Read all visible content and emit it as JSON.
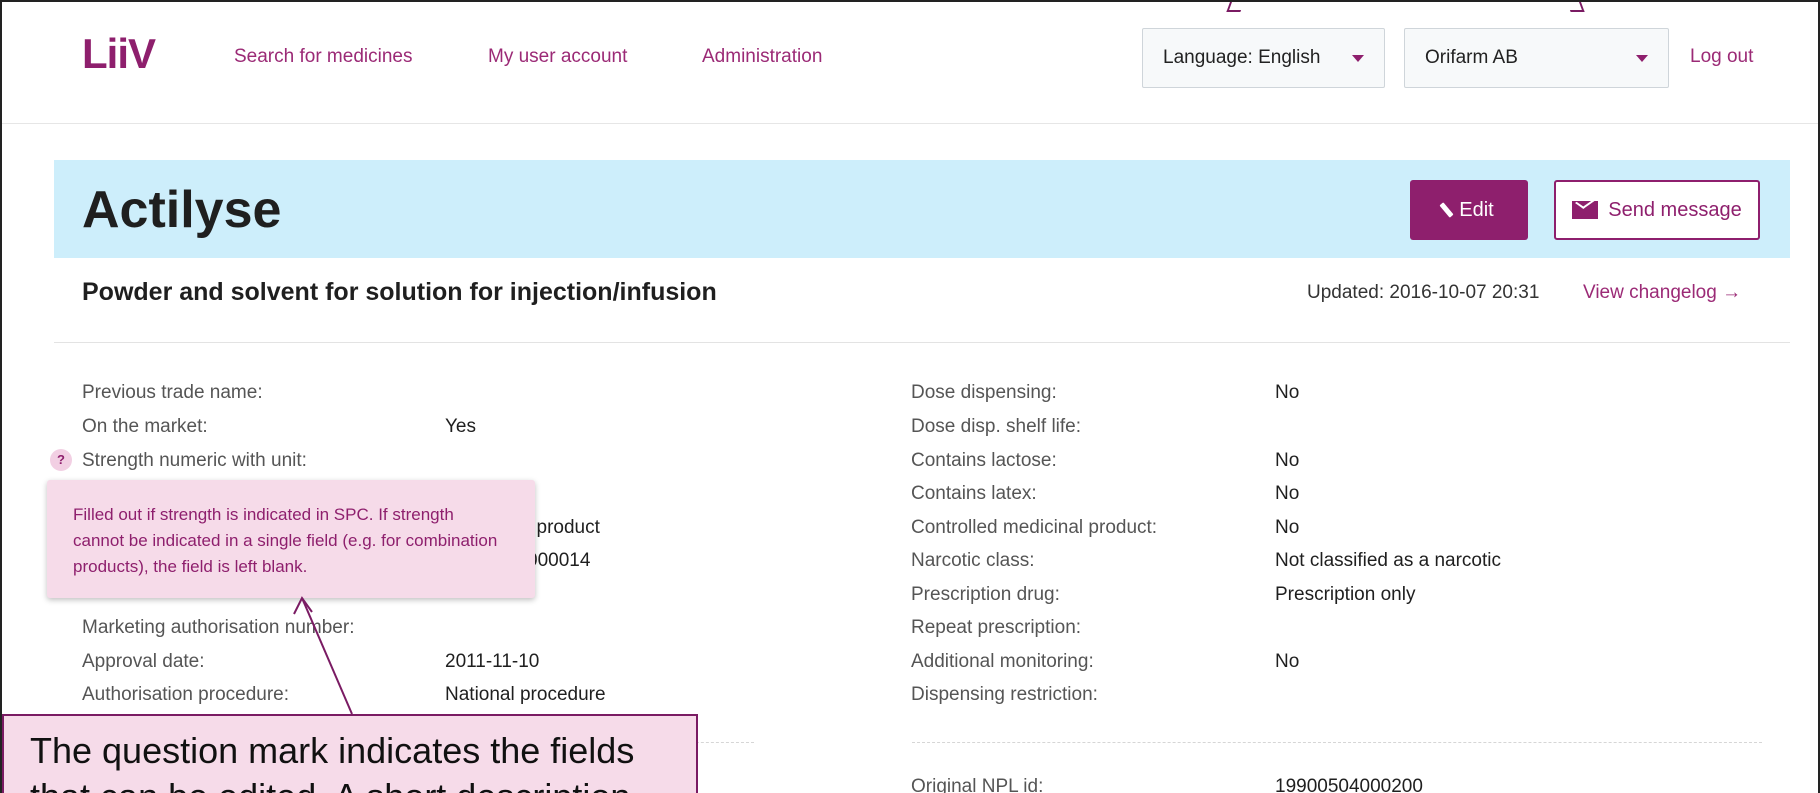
{
  "header": {
    "logo": "LiiV",
    "nav": [
      "Search for medicines",
      "My user account",
      "Administration"
    ],
    "language_select": "Language: English",
    "company_select": "Orifarm AB",
    "logout": "Log out"
  },
  "product": {
    "name": "Actilyse",
    "edit_label": "Edit",
    "message_label": "Send message",
    "form": "Powder and solvent for solution for injection/infusion",
    "updated": "Updated: 2016-10-07 20:31",
    "changelog": "View changelog →"
  },
  "left_fields": [
    {
      "label": "Previous trade name:",
      "value": ""
    },
    {
      "label": "On the market:",
      "value": "Yes"
    },
    {
      "label": "Strength numeric with unit:",
      "value": ""
    },
    {
      "label": "",
      "value": ""
    },
    {
      "label": "",
      "value": "l product"
    },
    {
      "label": "",
      "value": "000014"
    },
    {
      "label": "",
      "value": ""
    },
    {
      "label": "Marketing authorisation number:",
      "value": ""
    },
    {
      "label": "Approval date:",
      "value": "2011-11-10"
    },
    {
      "label": "Authorisation procedure:",
      "value": "National procedure"
    }
  ],
  "right_fields": [
    {
      "label": "Dose dispensing:",
      "value": "No"
    },
    {
      "label": "Dose disp. shelf life:",
      "value": ""
    },
    {
      "label": "Contains lactose:",
      "value": "No"
    },
    {
      "label": "Contains latex:",
      "value": "No"
    },
    {
      "label": "Controlled medicinal product:",
      "value": "No"
    },
    {
      "label": "Narcotic class:",
      "value": "Not classified as a narcotic"
    },
    {
      "label": "Prescription drug:",
      "value": "Prescription only"
    },
    {
      "label": "Repeat prescription:",
      "value": ""
    },
    {
      "label": "Additional monitoring:",
      "value": "No"
    },
    {
      "label": "Dispensing restriction:",
      "value": ""
    }
  ],
  "npl": {
    "label": "Original NPL id:",
    "value": "19900504000200"
  },
  "help_icon": "?",
  "tooltip": "Filled out if strength is indicated in SPC. If strength cannot be indicated in a single field (e.g. for combination products), the field is left blank.",
  "callout": "The question mark indicates the fields that can be edited. A short description"
}
